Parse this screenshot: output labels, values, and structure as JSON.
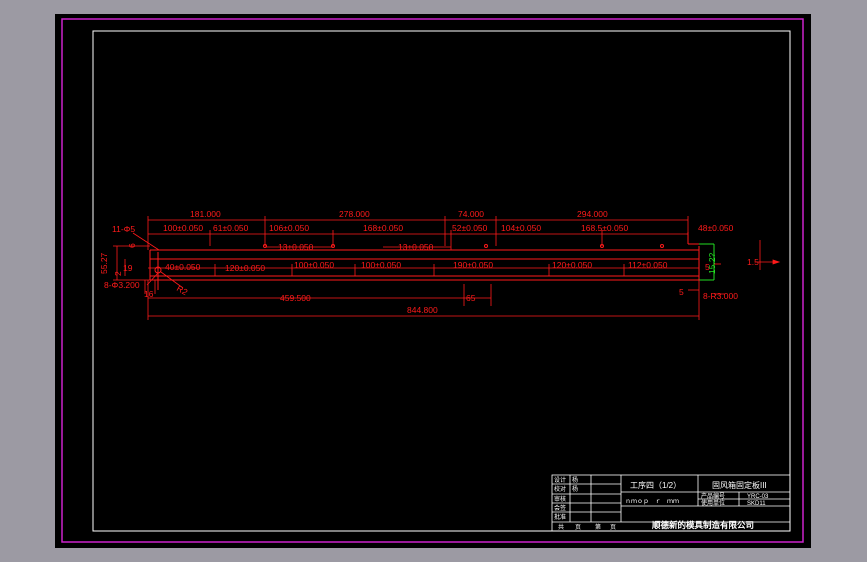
{
  "colors": {
    "background": "#9c9aa3",
    "sheet": "#000000",
    "border": "#cc22cc",
    "frame": "#ffffff",
    "dimension": "#ff1a1a",
    "highlight": "#22dd22"
  },
  "dimensions": {
    "top_row": [
      "181.000",
      "278.000",
      "74.000",
      "294.000"
    ],
    "second_row": [
      "100±0.050",
      "61±0.050",
      "106±0.050",
      "168±0.050",
      "52±0.050",
      "104±0.050",
      "168.5±0.050",
      "48±0.050"
    ],
    "third_row": [
      "13±0.050",
      "13±0.050"
    ],
    "lower_row": [
      "40±0.050",
      "120±0.050",
      "100±0.050",
      "100±0.050",
      "190±0.050",
      "120±0.050",
      "112±0.050"
    ],
    "bottom_overall": [
      "459.500",
      "65",
      "844.800"
    ],
    "left_side": [
      "11-Φ5",
      "55.27",
      "19",
      "6",
      "2",
      "8-Φ3.200",
      "16"
    ],
    "right_side": [
      "5",
      "5",
      "8-R3.000",
      "1.5"
    ],
    "misc": [
      "15.2?",
      "R2"
    ]
  },
  "title_block": {
    "left_labels": [
      "设计",
      "校对",
      "审核",
      "会签",
      "批准"
    ],
    "left_values": [
      "杨",
      "杨"
    ],
    "bottom_labels": [
      "共",
      "页",
      "第",
      "页"
    ],
    "process_title": "工序四（1/2）",
    "part_name": "固风箱固定板III",
    "product_code_label": "产品编号",
    "material_label": "使用单位",
    "product_code": "YRC-03",
    "material": "SKD11",
    "middle_row": "ｎｍｏｐ　ｒ　ｍｍ",
    "company": "顺德新的模具制造有限公司"
  }
}
